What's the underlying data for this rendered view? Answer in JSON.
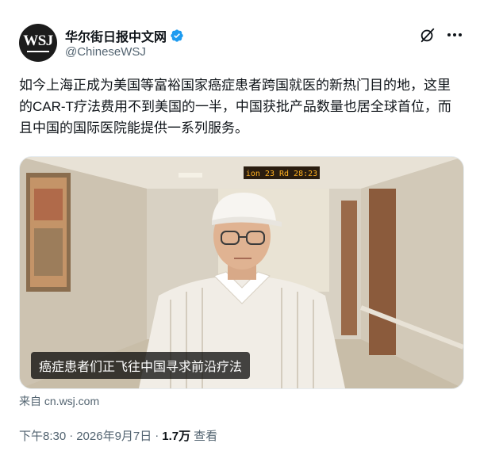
{
  "author": {
    "display_name": "华尔街日报中文网",
    "handle": "@ChineseWSJ",
    "avatar_text": "WSJ",
    "verified_color": "#1d9bf0"
  },
  "tweet": {
    "text": "如今上海正成为美国等富裕国家癌症患者跨国就医的新热门目的地，这里的CAR-T疗法费用不到美国的一半，中国获批产品数量也居全球首位，而且中国的国际医院能提供一系列服务。"
  },
  "media": {
    "caption": "癌症患者们正飞往中国寻求前沿疗法",
    "led_text": "ion 23 Rd 28:23"
  },
  "card": {
    "source": "来自 cn.wsj.com"
  },
  "meta": {
    "time": "下午8:30",
    "date": "2026年9月7日",
    "separator": "·",
    "views_count": "1.7万",
    "views_label": "查看"
  },
  "icons": {
    "grok": "grok-icon",
    "more": "more-dots-icon",
    "verified": "verified-badge-icon"
  }
}
